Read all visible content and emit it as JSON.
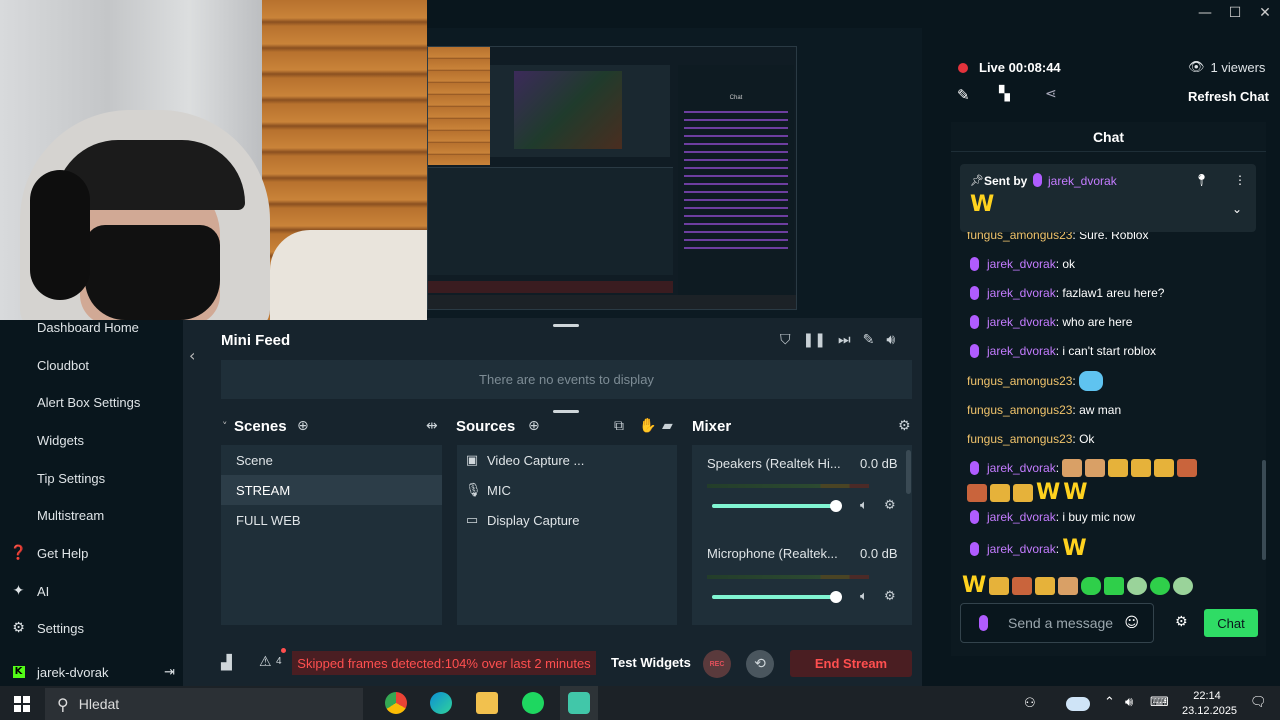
{
  "window": {
    "minimize_icon": "minimize-icon",
    "maximize_icon": "maximize-icon",
    "close_icon": "close-icon"
  },
  "preview": {
    "chat_title": "Chat",
    "no_events": "There are no events to display"
  },
  "sidebar": {
    "items": [
      {
        "label": "Dashboard Home",
        "icon": ""
      },
      {
        "label": "Cloudbot",
        "icon": ""
      },
      {
        "label": "Alert Box Settings",
        "icon": ""
      },
      {
        "label": "Widgets",
        "icon": ""
      },
      {
        "label": "Tip Settings",
        "icon": ""
      },
      {
        "label": "Multistream",
        "icon": ""
      },
      {
        "label": "Get Help",
        "icon": "help-icon"
      },
      {
        "label": "AI",
        "icon": "sparkle-icon"
      },
      {
        "label": "Settings",
        "icon": "gear-icon"
      }
    ],
    "user": "jarek-dvorak"
  },
  "minifeed": {
    "title": "Mini Feed",
    "empty": "There are no events to display"
  },
  "scenes": {
    "title": "Scenes",
    "items": [
      "Scene",
      "STREAM",
      "FULL WEB"
    ],
    "active": "STREAM"
  },
  "sources": {
    "title": "Sources",
    "items": [
      {
        "label": "Video Capture ...",
        "icon": "camera-icon"
      },
      {
        "label": "MIC",
        "icon": "mic-icon"
      },
      {
        "label": "Display Capture",
        "icon": "monitor-icon"
      }
    ]
  },
  "mixer": {
    "title": "Mixer",
    "channels": [
      {
        "name": "Speakers (Realtek Hi...",
        "db": "0.0 dB",
        "volume": 1.0
      },
      {
        "name": "Microphone (Realtek...",
        "db": "0.0 dB",
        "volume": 1.0
      }
    ]
  },
  "bottombar": {
    "notifications": "4",
    "skipped": "Skipped frames detected:104% over last 2 minutes",
    "test_widgets": "Test Widgets",
    "rec": "REC",
    "end_stream": "End Stream"
  },
  "live": {
    "status": "Live 00:08:44",
    "viewers": "1 viewers",
    "refresh": "Refresh Chat"
  },
  "chat": {
    "title": "Chat",
    "pinned_label": "Sent by",
    "pinned_user": "jarek_dvorak",
    "pinned_content": "W",
    "partial_message": {
      "user": "fungus_amongus23",
      "text": "Sure. Roblox"
    },
    "messages": [
      {
        "user": "jarek_dvorak",
        "text": "ok",
        "badge": true
      },
      {
        "user": "jarek_dvorak",
        "text": "fazlaw1 areu here?",
        "badge": true
      },
      {
        "user": "jarek_dvorak",
        "text": "who are here",
        "badge": true
      },
      {
        "user": "jarek_dvorak",
        "text": "i can't start roblox",
        "badge": true
      },
      {
        "user": "fungus_amongus23",
        "text": "",
        "badge": false
      },
      {
        "user": "fungus_amongus23",
        "text": "aw man",
        "badge": false
      },
      {
        "user": "fungus_amongus23",
        "text": "Ok",
        "badge": false
      },
      {
        "user": "jarek_dvorak",
        "text": "",
        "badge": true
      },
      {
        "user": "jarek_dvorak",
        "text": "i buy mic now",
        "badge": true
      },
      {
        "user": "jarek_dvorak",
        "text": "W",
        "badge": true
      }
    ],
    "emote_w": "W",
    "input_placeholder": "Send a message",
    "send_label": "Chat"
  },
  "taskbar": {
    "search_placeholder": "Hledat",
    "time": "22:14",
    "date": "23.12.2025"
  },
  "colors": {
    "accent": "#31c3a2",
    "chat_send": "#2fdc65",
    "danger": "#ff4f4f",
    "user_purple": "#c47cff",
    "user_gold": "#f0c36b"
  }
}
